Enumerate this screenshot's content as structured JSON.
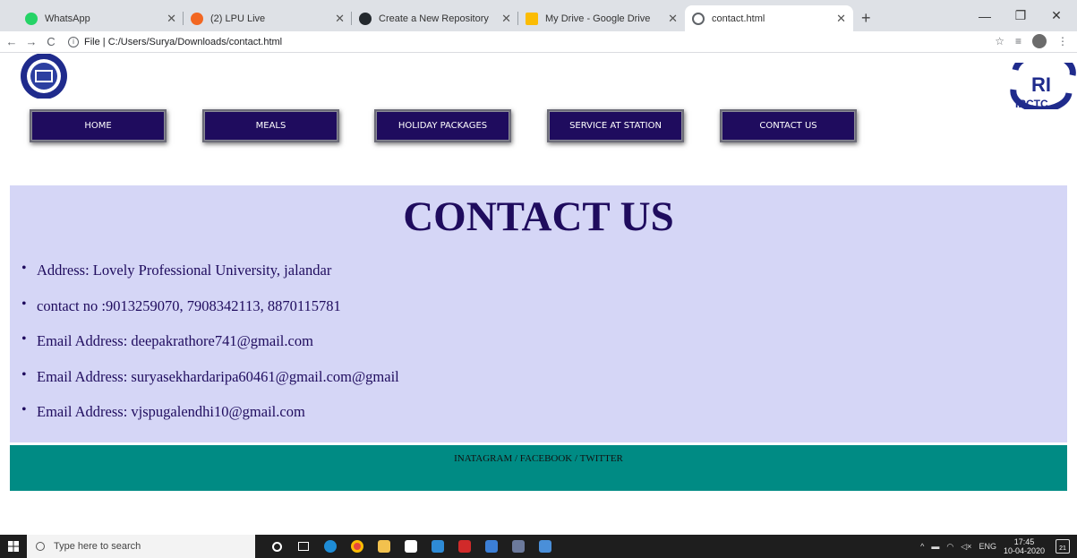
{
  "browser": {
    "tabs": [
      {
        "title": "WhatsApp",
        "favicon": "whatsapp-icon",
        "color": "#25d366"
      },
      {
        "title": "(2) LPU Live",
        "favicon": "lpu-live-icon",
        "color": "#f26722"
      },
      {
        "title": "Create a New Repository",
        "favicon": "github-icon",
        "color": "#24292e"
      },
      {
        "title": "My Drive - Google Drive",
        "favicon": "google-drive-icon",
        "color": "#fbbc04"
      },
      {
        "title": "contact.html",
        "favicon": "globe-icon",
        "color": "#5f6368",
        "active": true
      }
    ],
    "address": "File | C:/Users/Surya/Downloads/contact.html"
  },
  "page": {
    "nav": [
      "HOME",
      "MEALS",
      "HOLIDAY PACKAGES",
      "SERVICE AT STATION",
      "CONTACT US"
    ],
    "heading": "CONTACT US",
    "contacts": [
      "Address: Lovely Professional University, jalandar",
      "contact no :9013259070, 7908342113, 8870115781",
      "Email Address: deepakrathore741@gmail.com",
      "Email Address: suryasekhardaripa60461@gmail.com@gmail",
      "Email Address: vjspugalendhi10@gmail.com"
    ],
    "footer_links": "INATAGRAM / FACEBOOK / TWITTER",
    "logo_right_text": "IRCTC",
    "colors": {
      "nav_bg": "#1f0c5e",
      "contact_bg": "#d5d6f6",
      "footer_bg": "#008b84"
    }
  },
  "taskbar": {
    "search_placeholder": "Type here to search",
    "lang": "ENG",
    "time": "17:45",
    "date": "10-04-2020",
    "notifications": "21"
  }
}
